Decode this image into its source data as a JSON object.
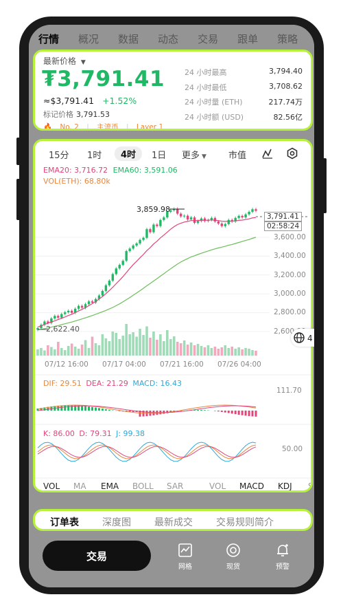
{
  "top_tabs": [
    "行情",
    "概况",
    "数据",
    "动态",
    "交易",
    "跟单",
    "策略"
  ],
  "price": {
    "label": "最新价格",
    "value": "₮3,791.41",
    "approx": "≈$3,791.41",
    "change": "+1.52%",
    "mark_label": "标记价格",
    "mark_value": "3,791.53",
    "tags": [
      "No. 2",
      "主流币",
      "Layer 1"
    ],
    "stats": [
      {
        "k": "24 小时最高",
        "v": "3,794.40"
      },
      {
        "k": "24 小时最低",
        "v": "3,708.62"
      },
      {
        "k": "24 小时量 (ETH)",
        "v": "217.74万"
      },
      {
        "k": "24 小时额 (USD)",
        "v": "82.56亿"
      }
    ]
  },
  "timeframes": [
    "15分",
    "1时",
    "4时",
    "1日",
    "更多",
    "市值"
  ],
  "active_timeframe": "4时",
  "legend": {
    "ema20": "EMA20: 3,716.72",
    "ema60": "EMA60: 3,591.06",
    "vol": "VOL(ETH): 68.80k",
    "dif": "DIF: 29.51",
    "dea": "DEA: 21.29",
    "macd": "MACD: 16.43",
    "k": "K: 86.00",
    "d": "D: 79.31",
    "j": "J: 99.38"
  },
  "chart_data": {
    "type": "candlestick",
    "y_ticks": [
      "3,600.00",
      "3,400.00",
      "3,200.00",
      "3,000.00",
      "2,800.00",
      "2,600.00"
    ],
    "x_ticks": [
      "07/12 16:00",
      "07/17 04:00",
      "07/21 16:00",
      "07/26 04:00"
    ],
    "ylim": [
      2600,
      3800
    ],
    "high_label": "3,859.98",
    "low_label": "2,622.40",
    "last_price": "3,791.41",
    "countdown": "02:58:24",
    "macd_tick": "111.70",
    "kdj_tick": "50.00",
    "close": [
      2640,
      2672,
      2705,
      2690,
      2735,
      2760,
      2742,
      2778,
      2795,
      2810,
      2790,
      2830,
      2858,
      2840,
      2875,
      2902,
      2890,
      2925,
      2960,
      3005,
      3060,
      3105,
      3170,
      3225,
      3260,
      3300,
      3395,
      3420,
      3450,
      3470,
      3505,
      3525,
      3610,
      3580,
      3655,
      3640,
      3700,
      3725,
      3780,
      3795,
      3810,
      3762,
      3735,
      3742,
      3705,
      3725,
      3672,
      3690,
      3715,
      3690,
      3700,
      3720,
      3685,
      3665,
      3640,
      3660,
      3700,
      3685,
      3720,
      3740,
      3725,
      3755,
      3780,
      3805,
      3790
    ],
    "ema20": [
      2650,
      2662,
      2676,
      2688,
      2700,
      2712,
      2724,
      2736,
      2750,
      2764,
      2776,
      2792,
      2808,
      2824,
      2840,
      2860,
      2880,
      2900,
      2925,
      2950,
      2978,
      3008,
      3040,
      3075,
      3110,
      3145,
      3185,
      3225,
      3262,
      3295,
      3330,
      3362,
      3400,
      3430,
      3465,
      3492,
      3525,
      3552,
      3580,
      3610,
      3635,
      3655,
      3668,
      3680,
      3686,
      3694,
      3694,
      3695,
      3698,
      3697,
      3698,
      3700,
      3698,
      3694,
      3688,
      3686,
      3688,
      3688,
      3691,
      3696,
      3699,
      3704,
      3711,
      3720,
      3725
    ],
    "ema60": [
      2622,
      2628,
      2635,
      2642,
      2650,
      2658,
      2665,
      2674,
      2683,
      2692,
      2700,
      2710,
      2720,
      2730,
      2741,
      2752,
      2763,
      2775,
      2788,
      2800,
      2814,
      2828,
      2843,
      2860,
      2878,
      2897,
      2918,
      2940,
      2962,
      2984,
      3007,
      3030,
      3055,
      3078,
      3102,
      3125,
      3150,
      3173,
      3198,
      3222,
      3246,
      3268,
      3288,
      3306,
      3322,
      3338,
      3350,
      3362,
      3374,
      3385,
      3396,
      3407,
      3417,
      3426,
      3434,
      3442,
      3452,
      3460,
      3470,
      3480,
      3489,
      3499,
      3509,
      3520,
      3530
    ],
    "volume": [
      0.18,
      0.22,
      0.15,
      0.3,
      0.25,
      0.18,
      0.4,
      0.22,
      0.16,
      0.28,
      0.35,
      0.26,
      0.2,
      0.32,
      0.45,
      0.22,
      0.55,
      0.36,
      0.3,
      0.62,
      0.5,
      0.42,
      0.7,
      0.66,
      0.48,
      0.58,
      0.92,
      0.62,
      0.68,
      0.55,
      0.78,
      0.6,
      0.85,
      0.52,
      0.7,
      0.46,
      0.62,
      0.42,
      0.74,
      0.48,
      0.56,
      0.4,
      0.36,
      0.44,
      0.32,
      0.38,
      0.3,
      0.34,
      0.28,
      0.24,
      0.3,
      0.22,
      0.26,
      0.2,
      0.24,
      0.3,
      0.22,
      0.26,
      0.2,
      0.24,
      0.18,
      0.22,
      0.2,
      0.16,
      0.14
    ]
  },
  "indicator_tabs": [
    "VOL",
    "MA",
    "EMA",
    "BOLL",
    "SAR",
    "VOL",
    "MACD",
    "KDJ",
    "S"
  ],
  "active_indicators": [
    "VOL",
    "EMA",
    "MACD",
    "KDJ"
  ],
  "bottom_tabs": [
    "订单表",
    "深度图",
    "最新成交",
    "交易规则简介"
  ],
  "bottom_bar": {
    "trade": "交易",
    "grid": "网格",
    "spot": "现货",
    "alert": "预警"
  }
}
